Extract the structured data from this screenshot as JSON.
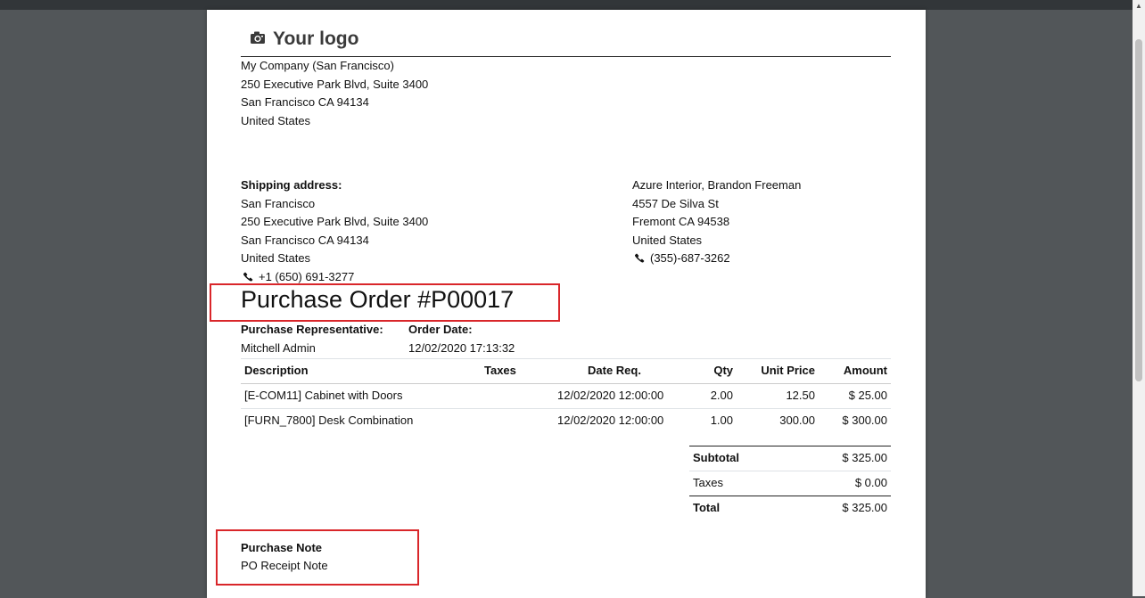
{
  "logo": {
    "text": "Your logo",
    "icon": "camera-icon"
  },
  "company": {
    "name": "My Company (San Francisco)",
    "street": "250 Executive Park Blvd, Suite 3400",
    "city": "San Francisco CA 94134",
    "country": "United States"
  },
  "shipping": {
    "heading": "Shipping address:",
    "name": "San Francisco",
    "street": "250 Executive Park Blvd, Suite 3400",
    "city": "San Francisco CA 94134",
    "country": "United States",
    "phone": "+1 (650) 691-3277"
  },
  "vendor": {
    "name": "Azure Interior, Brandon Freeman",
    "street": "4557 De Silva St",
    "city": "Fremont CA 94538",
    "country": "United States",
    "phone": "(355)-687-3262"
  },
  "title": "Purchase Order #P00017",
  "info": {
    "rep_label": "Purchase Representative:",
    "rep_value": "Mitchell Admin",
    "date_label": "Order Date:",
    "date_value": "12/02/2020 17:13:32"
  },
  "table": {
    "headers": [
      "Description",
      "Taxes",
      "Date Req.",
      "Qty",
      "Unit Price",
      "Amount"
    ],
    "rows": [
      [
        "[E-COM11] Cabinet with Doors",
        "",
        "12/02/2020 12:00:00",
        "2.00",
        "12.50",
        "$ 25.00"
      ],
      [
        "[FURN_7800] Desk Combination",
        "",
        "12/02/2020 12:00:00",
        "1.00",
        "300.00",
        "$ 300.00"
      ]
    ]
  },
  "totals": {
    "subtotal_label": "Subtotal",
    "subtotal_value": "$ 325.00",
    "taxes_label": "Taxes",
    "taxes_value": "$ 0.00",
    "total_label": "Total",
    "total_value": "$ 325.00"
  },
  "note": {
    "heading": "Purchase Note",
    "text": "PO Receipt Note"
  },
  "colors": {
    "highlight": "#d9262a",
    "viewer_bg": "#525659",
    "page_bg": "#ffffff"
  }
}
